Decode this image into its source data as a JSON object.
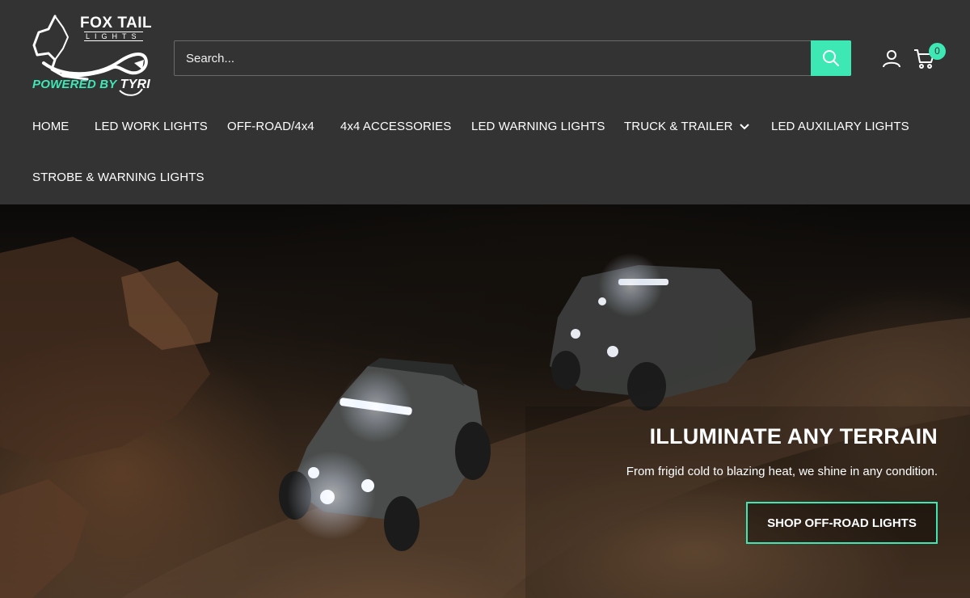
{
  "brand": {
    "logo_name": "FOX TAIL",
    "logo_sub": "LIGHTS",
    "powered_prefix": "POWERED BY ",
    "powered_brand": "TYRI",
    "accent_color": "#3ee8b5",
    "header_bg": "#333333"
  },
  "search": {
    "placeholder": "Search...",
    "value": "",
    "button_icon": "search-icon"
  },
  "header_actions": {
    "account_icon": "user-icon",
    "cart_icon": "cart-icon",
    "cart_count": "0"
  },
  "nav": {
    "items": [
      {
        "label": "HOME"
      },
      {
        "label": "LED WORK LIGHTS"
      },
      {
        "label": "OFF-ROAD/4x4"
      },
      {
        "label": "4x4 ACCESSORIES"
      },
      {
        "label": "LED WARNING LIGHTS"
      },
      {
        "label": "TRUCK & TRAILER",
        "icon": "chevron-down-icon"
      },
      {
        "label": "LED AUXILIARY LIGHTS"
      },
      {
        "label": "STROBE & WARNING LIGHTS"
      }
    ]
  },
  "hero": {
    "title": "ILLUMINATE ANY TERRAIN",
    "subtitle": "From frigid cold to blazing heat, we shine in any condition.",
    "cta_label": "SHOP OFF-ROAD LIGHTS"
  }
}
